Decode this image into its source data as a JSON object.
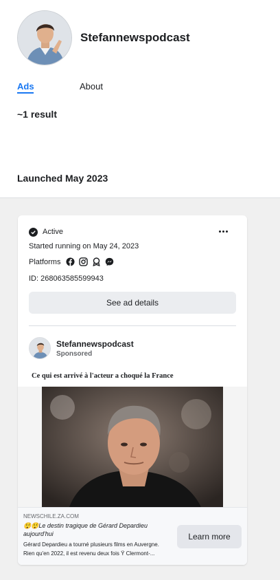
{
  "profile": {
    "name": "Stefannewspodcast"
  },
  "tabs": [
    {
      "label": "Ads",
      "active": true
    },
    {
      "label": "About",
      "active": false
    }
  ],
  "results": {
    "count_text": "~1 result",
    "group_heading": "Launched May 2023"
  },
  "ad": {
    "status": "Active",
    "started": "Started running on May 24, 2023",
    "platforms_label": "Platforms",
    "platform_icons": [
      "facebook-icon",
      "instagram-icon",
      "audience-network-icon",
      "messenger-icon"
    ],
    "id_text": "ID: 268063585599943",
    "details_button": "See ad details",
    "advertiser": "Stefannewspodcast",
    "sponsored": "Sponsored",
    "headline": "Ce qui est arrivé à l'acteur a choqué la France",
    "link": {
      "domain": "NEWSCHILE.ZA.COM",
      "title": "😲😲Le destin tragique de Gérard Depardieu aujourd'hui",
      "description_line1": "Gérard Depardieu a tourné plusieurs films en Auvergne.",
      "description_line2": "Rien qu'en 2022, il est revenu deux fois Ÿ Clermont-...",
      "cta": "Learn more"
    }
  },
  "colors": {
    "accent": "#1877f2",
    "page_bg": "#f0f0f0",
    "button_bg": "#ebedf0"
  }
}
